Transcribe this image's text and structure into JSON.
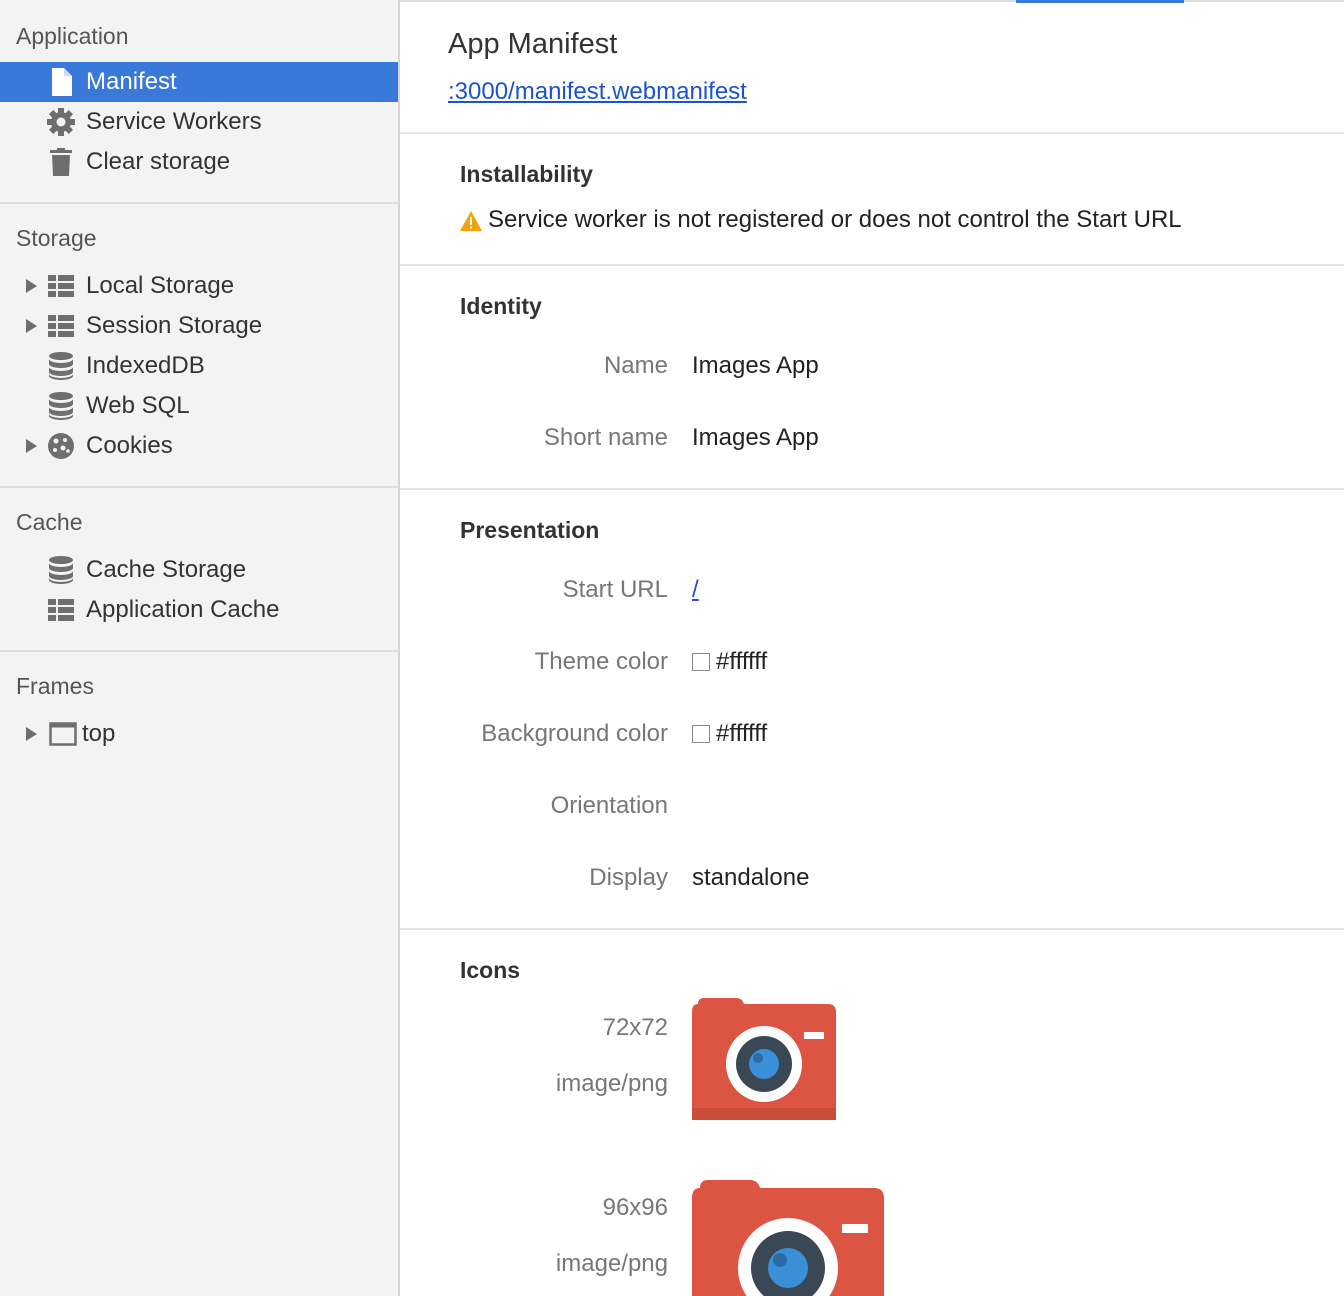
{
  "sidebar": {
    "application": {
      "title": "Application",
      "items": [
        {
          "label": "Manifest",
          "icon": "document-icon"
        },
        {
          "label": "Service Workers",
          "icon": "gear-icon"
        },
        {
          "label": "Clear storage",
          "icon": "trash-icon"
        }
      ]
    },
    "storage": {
      "title": "Storage",
      "items": [
        {
          "label": "Local Storage",
          "icon": "grid-icon"
        },
        {
          "label": "Session Storage",
          "icon": "grid-icon"
        },
        {
          "label": "IndexedDB",
          "icon": "database-icon"
        },
        {
          "label": "Web SQL",
          "icon": "database-icon"
        },
        {
          "label": "Cookies",
          "icon": "cookie-icon"
        }
      ]
    },
    "cache": {
      "title": "Cache",
      "items": [
        {
          "label": "Cache Storage",
          "icon": "database-icon"
        },
        {
          "label": "Application Cache",
          "icon": "grid-icon"
        }
      ]
    },
    "frames": {
      "title": "Frames",
      "items": [
        {
          "label": "top",
          "icon": "frame-icon"
        }
      ]
    }
  },
  "main": {
    "title": "App Manifest",
    "manifest_link": ":3000/manifest.webmanifest",
    "installability": {
      "heading": "Installability",
      "warning": "Service worker is not registered or does not control the Start URL"
    },
    "identity": {
      "heading": "Identity",
      "name_label": "Name",
      "name_value": "Images App",
      "short_name_label": "Short name",
      "short_name_value": "Images App"
    },
    "presentation": {
      "heading": "Presentation",
      "start_url_label": "Start URL",
      "start_url_value": "/",
      "theme_color_label": "Theme color",
      "theme_color_value": "#ffffff",
      "background_color_label": "Background color",
      "background_color_value": "#ffffff",
      "orientation_label": "Orientation",
      "orientation_value": "",
      "display_label": "Display",
      "display_value": "standalone"
    },
    "icons": {
      "heading": "Icons",
      "items": [
        {
          "size": "72x72",
          "type": "image/png"
        },
        {
          "size": "96x96",
          "type": "image/png"
        }
      ]
    }
  },
  "colors": {
    "accent": "#3879d9",
    "link": "#1a53d1",
    "camera_body": "#db5542",
    "warning": "#f2a20c"
  }
}
